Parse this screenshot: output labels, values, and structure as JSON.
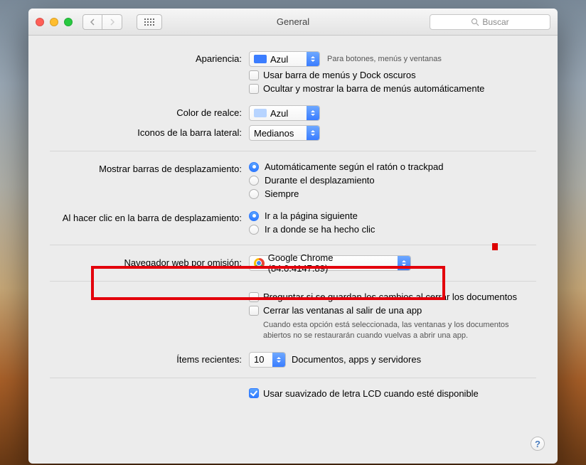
{
  "window": {
    "title": "General"
  },
  "search": {
    "placeholder": "Buscar"
  },
  "appearance": {
    "label": "Apariencia:",
    "value": "Azul",
    "note": "Para botones, menús y ventanas",
    "dark_menu": "Usar barra de menús y Dock oscuros",
    "auto_hide": "Ocultar y mostrar la barra de menús automáticamente"
  },
  "highlight": {
    "label": "Color de realce:",
    "value": "Azul"
  },
  "sidebar_icons": {
    "label": "Iconos de la barra lateral:",
    "value": "Medianos"
  },
  "scrollbars": {
    "label": "Mostrar barras de desplazamiento:",
    "opt_auto": "Automáticamente según el ratón o trackpad",
    "opt_scrolling": "Durante el desplazamiento",
    "opt_always": "Siempre"
  },
  "scroll_click": {
    "label": "Al hacer clic en la barra de desplazamiento:",
    "opt_next": "Ir a la página siguiente",
    "opt_here": "Ir a donde se ha hecho clic"
  },
  "browser": {
    "label": "Navegador web por omisión:",
    "value": "Google Chrome (84.0.4147.89)"
  },
  "save": {
    "ask": "Preguntar si se guardan los cambios al cerrar los documentos",
    "close": "Cerrar las ventanas al salir de una app",
    "hint": "Cuando esta opción está seleccionada, las ventanas y los documentos abiertos no se restaurarán cuando vuelvas a abrir una app."
  },
  "recent": {
    "label": "Ítems recientes:",
    "value": "10",
    "suffix": "Documentos, apps y servidores"
  },
  "lcd": {
    "label": "Usar suavizado de letra LCD cuando esté disponible"
  },
  "help": "?"
}
